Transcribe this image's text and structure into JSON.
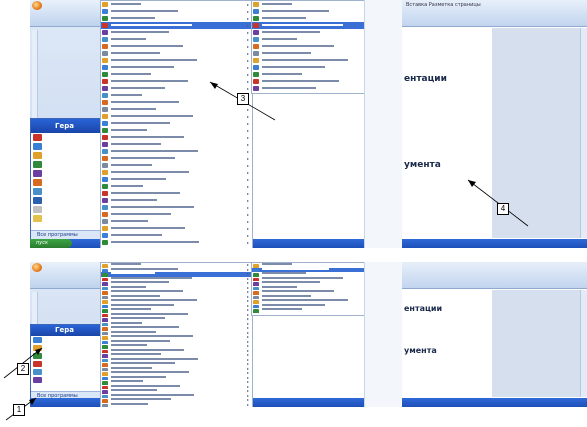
{
  "callouts": {
    "c1": "1",
    "c2": "2",
    "c3": "3",
    "c4": "4"
  },
  "start_menu": {
    "user": "Гера",
    "all_programs": "Все программы",
    "start": "пуск"
  },
  "document": {
    "heading1": "ентации",
    "heading2": "умента",
    "word_tabs": "Вставка  Разметка страницы"
  },
  "colors": {
    "highlight": "#3a6fd6",
    "taskbar": "#2f69d9",
    "start_green": "#3ea646"
  }
}
